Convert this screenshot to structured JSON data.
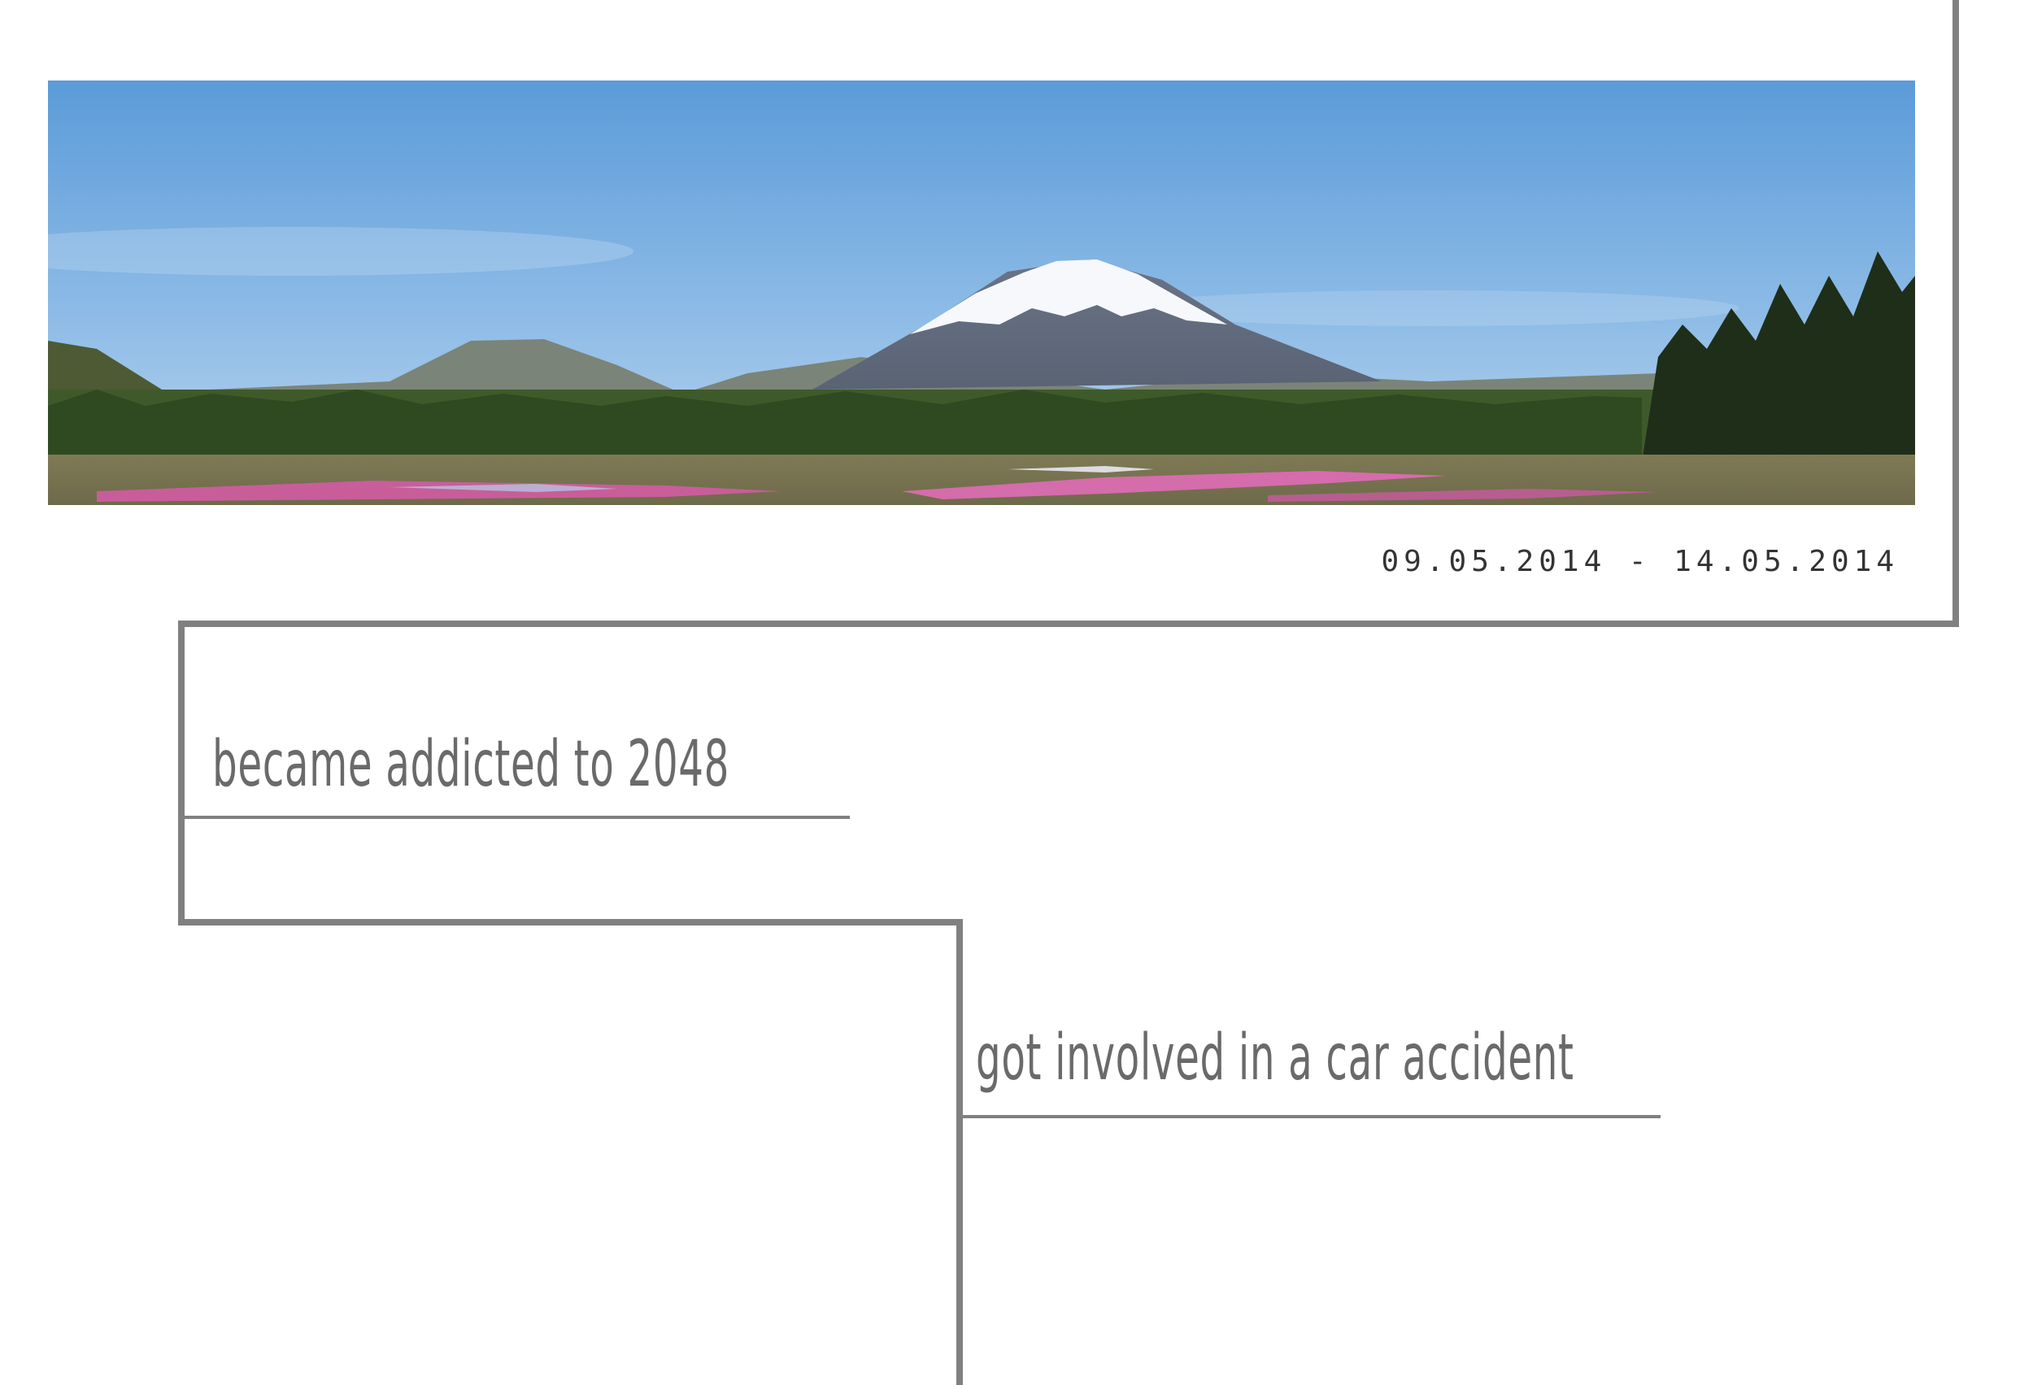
{
  "hero": {
    "image_name": "mount-fuji-panorama",
    "date_range": "09.05.2014 - 14.05.2014"
  },
  "events": [
    {
      "label": "became addicted to 2048"
    },
    {
      "label": "got involved in a car accident"
    }
  ],
  "colors": {
    "line": "#808080",
    "text": "#6a6a6a",
    "date_text": "#333333",
    "sky": "#6fa8dc",
    "flowers": "#d85aa8"
  }
}
